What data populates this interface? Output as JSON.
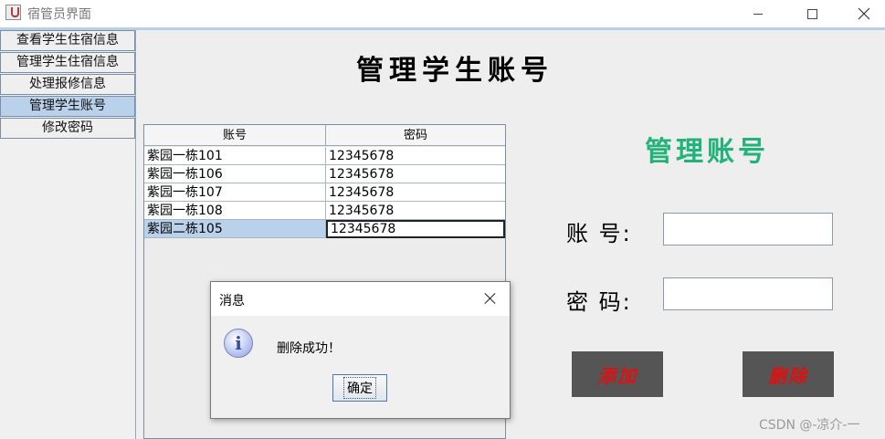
{
  "window": {
    "title": "宿管员界面",
    "controls": {
      "minimize_icon": "minimize-icon",
      "maximize_icon": "maximize-icon",
      "close_icon": "close-icon"
    }
  },
  "sidebar": {
    "items": [
      {
        "label": "查看学生住宿信息",
        "active": false
      },
      {
        "label": "管理学生住宿信息",
        "active": false
      },
      {
        "label": "处理报修信息",
        "active": false
      },
      {
        "label": "管理学生账号",
        "active": true
      },
      {
        "label": "修改密码",
        "active": false
      }
    ]
  },
  "main": {
    "heading": "管理学生账号",
    "table": {
      "columns": [
        "账号",
        "密码"
      ],
      "rows": [
        {
          "account": "紫园一栋101",
          "password": "12345678"
        },
        {
          "account": "紫园一栋106",
          "password": "12345678"
        },
        {
          "account": "紫园一栋107",
          "password": "12345678"
        },
        {
          "account": "紫园一栋108",
          "password": "12345678"
        },
        {
          "account": "紫园二栋105",
          "password": "12345678"
        }
      ],
      "selected_row_index": 4
    },
    "form": {
      "title": "管理账号",
      "account_label": "账 号:",
      "account_value": "",
      "password_label": "密 码:",
      "password_value": "",
      "add_button": "添加",
      "delete_button": "删除"
    }
  },
  "dialog": {
    "title": "消息",
    "icon": "info-icon",
    "icon_glyph": "i",
    "message": "删除成功！",
    "ok_button": "确定"
  },
  "watermark": "CSDN @-凉介-一",
  "colors": {
    "form_title": "#21b37a",
    "action_button_bg": "#555555",
    "action_button_text": "#e01010",
    "selection": "#b9d1ea"
  }
}
